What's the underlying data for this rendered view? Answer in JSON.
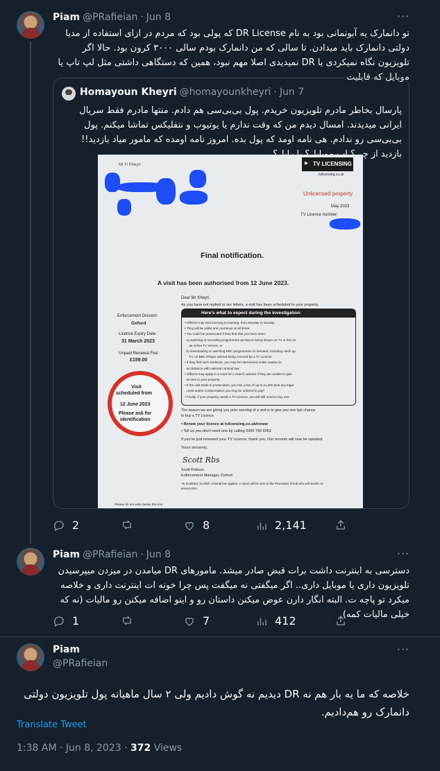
{
  "tweet1": {
    "name": "Piam",
    "handle": "@PRafieian",
    "dot": "·",
    "date": "Jun 8",
    "more": "···",
    "text": "تو دانمارک یه آبونمانی بود به نام DR License که پولی بود که مردم در ازای استفاده از مدیا دولتی دانمارک باید میدادن. تا سالی که من دانمارک بودم سالی ۳۰۰۰ کرون بود. حالا اگر تلویزیون نگاه نمیکردی یا DR نمیدیدی اصلا مهم نبود، همین که دستگاهی داشتی مثل لپ تاپ یا موبایل که قابلیت",
    "quote": {
      "name": "Homayoun Kheyri",
      "handle": "@homayounkheyri",
      "dot": "·",
      "date": "Jun 7",
      "text": "پارسال بخاطر مادرم تلویزیون خریدم. پول بی‌بی‌سی هم دادم. منتها مادرم فقط سریال ایرانی میدیدند. امسال دیدم من که وقت ندارم یا یوتیوب و نتفلیکس تماشا میکنم. پول بی‌بی‌سی رو ندادم. هی نامه اومد که پول بده. امروز نامه اومده که مامور میاد بازدید!! بازدید از چی؟ اپ موبایل؟ با رابل؟",
      "letter": {
        "brand": "TV LICENSING",
        "site": "tvlicensing.co.uk",
        "addressee": "Mr H Kheyri",
        "unlicensed": "Unlicensed property",
        "month": "May 2023",
        "licence_number": "TV Licence number:",
        "final": "Final notification.",
        "visit": "A visit has been authorised from 12 June 2023.",
        "dear": "Dear Mr Kheyri,",
        "not_replied": "As you have not replied to our letters, a visit has been scheduled to your property.",
        "enf_label": "Enforcement Division:",
        "enf_value": "Oxford",
        "expiry_label": "Licence Expiry Date:",
        "expiry_value": "31 March 2023",
        "fee_label": "Unpaid Renewal Fee:",
        "fee_value": "£159.00",
        "box_title": "Here's what to expect during the investigation:",
        "box_lines": [
          "• Officers may visit morning to evening, from Monday to Sunday.",
          "• They will be polite and courteous at all times.",
          "• You could be prosecuted if they find that you have been:",
          "  a) watching or recording programmes as they're being shown on TV or live on",
          "     an online TV service, or",
          "  b) downloading or watching BBC programmes on demand, including catch up",
          "     TV, on BBC iPlayer without being covered by a TV Licence.",
          "• If they find such evidence, you may be interviewed under caution in",
          "  accordance with national criminal law.",
          "• Officers may apply to a court for a search warrant if they are unable to gain",
          "  access to your property.",
          "• If the visit leads to prosecution, you risk a fine of up to £1,000 plus any legal",
          "  costs and/or compensation you may be ordered to pay*",
          "• Finally, if your property needs a TV Licence, you will still need to buy one."
        ],
        "stamp_1": "Visit",
        "stamp_2": "scheduled from",
        "stamp_3": "12 June 2023",
        "stamp_4": "Please ask for",
        "stamp_5": "identification",
        "reason": "The reason we are giving you prior warning of a visit is to give you one last chance",
        "reason2": "to buy a TV Licence.",
        "renew": "• Renew your licence at tvlicensing.co.uk/renew",
        "call": "• Tell us you don't need one by calling 0300 790 6062.",
        "just": "If you've just renewed your TV Licence, thank you. Our records will now be updated.",
        "yours": "Yours sincerely,",
        "signature": "Scott Rbs",
        "signer": "Scott Robson",
        "signer_title": "Enforcement Manager, Oxford",
        "footnote": "*In Scotland, Scottish criminal law applies. A report will be sent to the Procurator Fiscal who will decide on",
        "footnote2": "prosecution.",
        "bottom": "Please do not write below this line"
      }
    },
    "replies": "2",
    "retweets": "",
    "likes": "8",
    "views": "2,141"
  },
  "tweet2": {
    "name": "Piam",
    "handle": "@PRafieian",
    "dot": "·",
    "date": "Jun 8",
    "more": "···",
    "text": "دسترسی به اینترنت داشت برات قبض صادر میشد. مامورهای DR میامدن در میزدن میپرسیدن تلویزیون داری یا موبایل داری.. اگر میگفتی نه میگفت پس چرا خونه ات اینترنت داری و خلاصه میکرد تو پاچه ت. البته انگار دارن عوض میکنن داستان رو و اینو اضافه میکنن رو مالیات (نه که خیلی مالیات کمه)",
    "replies": "1",
    "retweets": "",
    "likes": "7",
    "views": "412"
  },
  "tweet3": {
    "name": "Piam",
    "handle": "@PRafieian",
    "more": "···",
    "text": "خلاصه که ما یه بار هم نه DR دیدیم نه گوش دادیم ولی ۲ سال ماهیانه پول تلویزیون دولتی دانمارک رو هم‌دادیم.",
    "translate": "Translate Tweet",
    "time": "1:38 AM · Jun 8, 2023 · ",
    "views_count": "372",
    "views_label": " Views"
  },
  "colors": {
    "background": "#15202b",
    "text": "#f7f9f9",
    "muted": "#8b98a5",
    "link": "#1d9bf0",
    "border": "#38444d"
  }
}
